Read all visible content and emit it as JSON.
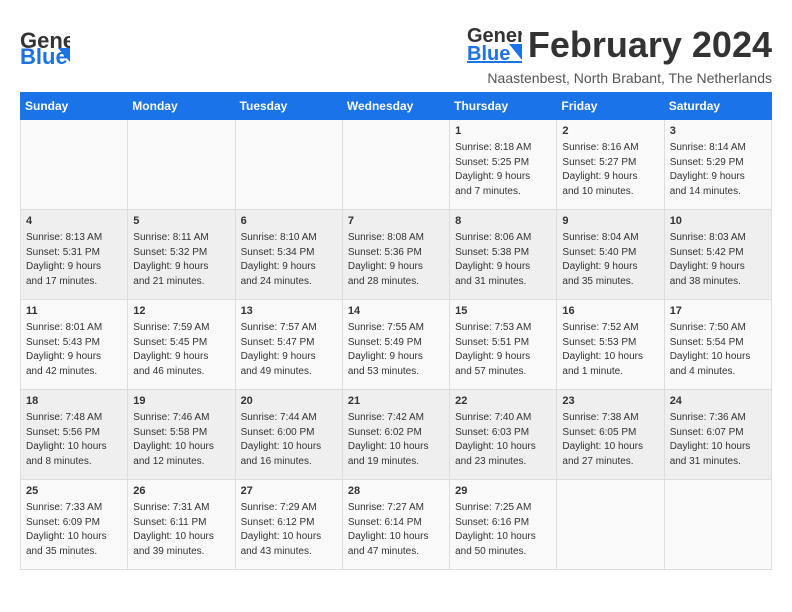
{
  "header": {
    "logo_line1": "General",
    "logo_line2": "Blue",
    "month": "February 2024",
    "location": "Naastenbest, North Brabant, The Netherlands"
  },
  "days_of_week": [
    "Sunday",
    "Monday",
    "Tuesday",
    "Wednesday",
    "Thursday",
    "Friday",
    "Saturday"
  ],
  "weeks": [
    [
      {
        "day": "",
        "info": ""
      },
      {
        "day": "",
        "info": ""
      },
      {
        "day": "",
        "info": ""
      },
      {
        "day": "",
        "info": ""
      },
      {
        "day": "1",
        "info": "Sunrise: 8:18 AM\nSunset: 5:25 PM\nDaylight: 9 hours\nand 7 minutes."
      },
      {
        "day": "2",
        "info": "Sunrise: 8:16 AM\nSunset: 5:27 PM\nDaylight: 9 hours\nand 10 minutes."
      },
      {
        "day": "3",
        "info": "Sunrise: 8:14 AM\nSunset: 5:29 PM\nDaylight: 9 hours\nand 14 minutes."
      }
    ],
    [
      {
        "day": "4",
        "info": "Sunrise: 8:13 AM\nSunset: 5:31 PM\nDaylight: 9 hours\nand 17 minutes."
      },
      {
        "day": "5",
        "info": "Sunrise: 8:11 AM\nSunset: 5:32 PM\nDaylight: 9 hours\nand 21 minutes."
      },
      {
        "day": "6",
        "info": "Sunrise: 8:10 AM\nSunset: 5:34 PM\nDaylight: 9 hours\nand 24 minutes."
      },
      {
        "day": "7",
        "info": "Sunrise: 8:08 AM\nSunset: 5:36 PM\nDaylight: 9 hours\nand 28 minutes."
      },
      {
        "day": "8",
        "info": "Sunrise: 8:06 AM\nSunset: 5:38 PM\nDaylight: 9 hours\nand 31 minutes."
      },
      {
        "day": "9",
        "info": "Sunrise: 8:04 AM\nSunset: 5:40 PM\nDaylight: 9 hours\nand 35 minutes."
      },
      {
        "day": "10",
        "info": "Sunrise: 8:03 AM\nSunset: 5:42 PM\nDaylight: 9 hours\nand 38 minutes."
      }
    ],
    [
      {
        "day": "11",
        "info": "Sunrise: 8:01 AM\nSunset: 5:43 PM\nDaylight: 9 hours\nand 42 minutes."
      },
      {
        "day": "12",
        "info": "Sunrise: 7:59 AM\nSunset: 5:45 PM\nDaylight: 9 hours\nand 46 minutes."
      },
      {
        "day": "13",
        "info": "Sunrise: 7:57 AM\nSunset: 5:47 PM\nDaylight: 9 hours\nand 49 minutes."
      },
      {
        "day": "14",
        "info": "Sunrise: 7:55 AM\nSunset: 5:49 PM\nDaylight: 9 hours\nand 53 minutes."
      },
      {
        "day": "15",
        "info": "Sunrise: 7:53 AM\nSunset: 5:51 PM\nDaylight: 9 hours\nand 57 minutes."
      },
      {
        "day": "16",
        "info": "Sunrise: 7:52 AM\nSunset: 5:53 PM\nDaylight: 10 hours\nand 1 minute."
      },
      {
        "day": "17",
        "info": "Sunrise: 7:50 AM\nSunset: 5:54 PM\nDaylight: 10 hours\nand 4 minutes."
      }
    ],
    [
      {
        "day": "18",
        "info": "Sunrise: 7:48 AM\nSunset: 5:56 PM\nDaylight: 10 hours\nand 8 minutes."
      },
      {
        "day": "19",
        "info": "Sunrise: 7:46 AM\nSunset: 5:58 PM\nDaylight: 10 hours\nand 12 minutes."
      },
      {
        "day": "20",
        "info": "Sunrise: 7:44 AM\nSunset: 6:00 PM\nDaylight: 10 hours\nand 16 minutes."
      },
      {
        "day": "21",
        "info": "Sunrise: 7:42 AM\nSunset: 6:02 PM\nDaylight: 10 hours\nand 19 minutes."
      },
      {
        "day": "22",
        "info": "Sunrise: 7:40 AM\nSunset: 6:03 PM\nDaylight: 10 hours\nand 23 minutes."
      },
      {
        "day": "23",
        "info": "Sunrise: 7:38 AM\nSunset: 6:05 PM\nDaylight: 10 hours\nand 27 minutes."
      },
      {
        "day": "24",
        "info": "Sunrise: 7:36 AM\nSunset: 6:07 PM\nDaylight: 10 hours\nand 31 minutes."
      }
    ],
    [
      {
        "day": "25",
        "info": "Sunrise: 7:33 AM\nSunset: 6:09 PM\nDaylight: 10 hours\nand 35 minutes."
      },
      {
        "day": "26",
        "info": "Sunrise: 7:31 AM\nSunset: 6:11 PM\nDaylight: 10 hours\nand 39 minutes."
      },
      {
        "day": "27",
        "info": "Sunrise: 7:29 AM\nSunset: 6:12 PM\nDaylight: 10 hours\nand 43 minutes."
      },
      {
        "day": "28",
        "info": "Sunrise: 7:27 AM\nSunset: 6:14 PM\nDaylight: 10 hours\nand 47 minutes."
      },
      {
        "day": "29",
        "info": "Sunrise: 7:25 AM\nSunset: 6:16 PM\nDaylight: 10 hours\nand 50 minutes."
      },
      {
        "day": "",
        "info": ""
      },
      {
        "day": "",
        "info": ""
      }
    ]
  ]
}
